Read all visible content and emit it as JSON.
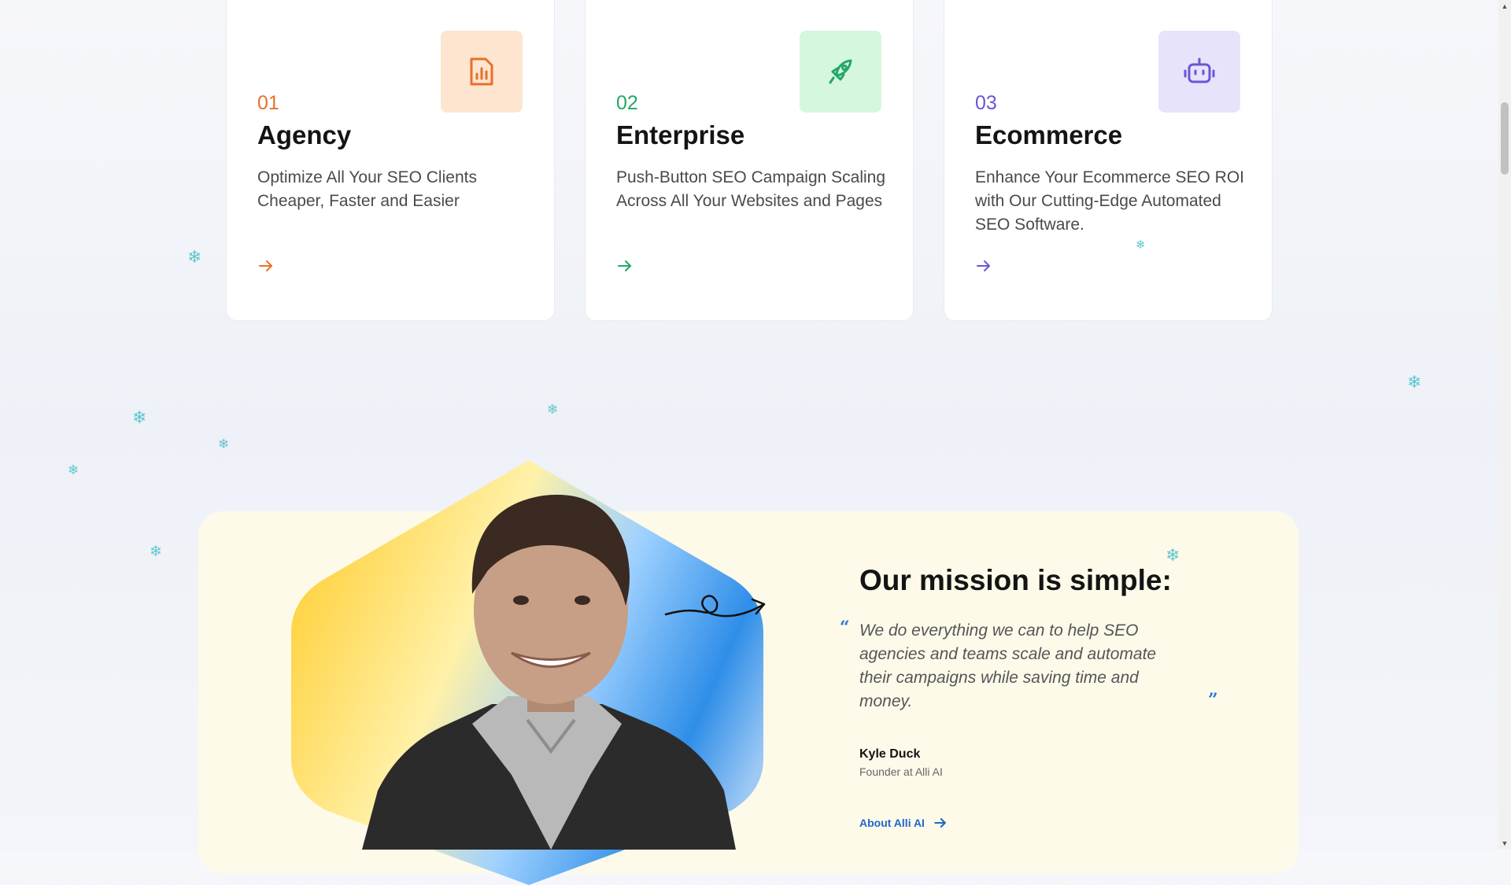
{
  "cards": [
    {
      "number": "01",
      "title": "Agency",
      "description": "Optimize All Your SEO Clients Cheaper, Faster and Easier",
      "icon": "chart-document-icon",
      "accent": "#e8702a",
      "icon_bg": "#fde5cf"
    },
    {
      "number": "02",
      "title": "Enterprise",
      "description": "Push-Button SEO Campaign Scaling Across All Your Websites and Pages",
      "icon": "rocket-icon",
      "accent": "#22a866",
      "icon_bg": "#d5f7dd"
    },
    {
      "number": "03",
      "title": "Ecommerce",
      "description": "Enhance Your Ecommerce SEO ROI with Our Cutting-Edge Automated SEO Software.",
      "icon": "robot-icon",
      "accent": "#6b56d6",
      "icon_bg": "#e7e3fb"
    }
  ],
  "mission": {
    "title": "Our mission is simple:",
    "quote_open": "“",
    "quote": "We do everything we can to help SEO agencies and teams scale and automate their campaigns while saving time and money.",
    "quote_close": "”",
    "author_name": "Kyle Duck",
    "author_role": "Founder at Alli AI",
    "link_label": "About Alli AI",
    "link_color": "#1f67c6",
    "panel_color": "#fdfaea"
  },
  "decoration": {
    "snowflake": "❄",
    "snowflake_color": "#5fc6cf"
  }
}
